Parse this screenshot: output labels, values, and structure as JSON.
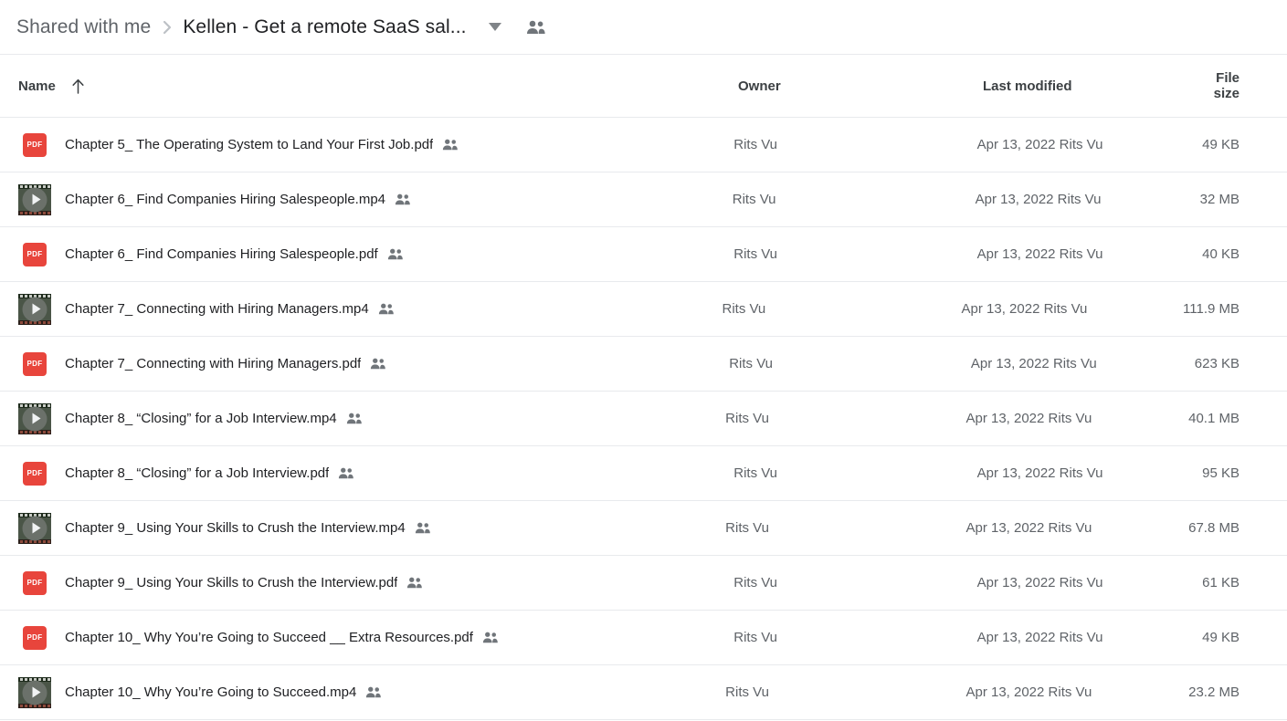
{
  "breadcrumb": {
    "root_label": "Shared with me",
    "separator": "›",
    "current_label": "Kellen - Get a remote SaaS sal...",
    "caret_icon": "chevron-down-icon",
    "people_icon": "people-shared-icon"
  },
  "columns": {
    "name": "Name",
    "owner": "Owner",
    "last_modified": "Last modified",
    "file_size": "File size",
    "sort_arrow": "↑",
    "sort_direction": "ascending"
  },
  "icons": {
    "pdf_label": "PDF",
    "pdf_color": "#e8453c",
    "video_label": "video-thumbnail-icon",
    "share_label": "shared-people-icon"
  },
  "files": [
    {
      "type": "pdf",
      "name": "Chapter 5_ The Operating System to Land Your First Job.pdf",
      "shared": true,
      "owner": "Rits Vu",
      "last_modified": "Apr 13, 2022  Rits Vu",
      "size": "49 KB"
    },
    {
      "type": "video",
      "name": "Chapter 6_ Find Companies Hiring Salespeople.mp4",
      "shared": true,
      "owner": "Rits Vu",
      "last_modified": "Apr 13, 2022  Rits Vu",
      "size": "32 MB"
    },
    {
      "type": "pdf",
      "name": "Chapter 6_ Find Companies Hiring Salespeople.pdf",
      "shared": true,
      "owner": "Rits Vu",
      "last_modified": "Apr 13, 2022  Rits Vu",
      "size": "40 KB"
    },
    {
      "type": "video",
      "name": "Chapter 7_ Connecting with Hiring Managers.mp4",
      "shared": true,
      "owner": "Rits Vu",
      "last_modified": "Apr 13, 2022  Rits Vu",
      "size": "111.9 MB"
    },
    {
      "type": "pdf",
      "name": "Chapter 7_ Connecting with Hiring Managers.pdf",
      "shared": true,
      "owner": "Rits Vu",
      "last_modified": "Apr 13, 2022  Rits Vu",
      "size": "623 KB"
    },
    {
      "type": "video",
      "name": "Chapter 8_ “Closing” for a Job Interview.mp4",
      "shared": true,
      "owner": "Rits Vu",
      "last_modified": "Apr 13, 2022  Rits Vu",
      "size": "40.1 MB"
    },
    {
      "type": "pdf",
      "name": "Chapter 8_ “Closing” for a Job Interview.pdf",
      "shared": true,
      "owner": "Rits Vu",
      "last_modified": "Apr 13, 2022  Rits Vu",
      "size": "95 KB"
    },
    {
      "type": "video",
      "name": "Chapter 9_ Using Your Skills to Crush the Interview.mp4",
      "shared": true,
      "owner": "Rits Vu",
      "last_modified": "Apr 13, 2022  Rits Vu",
      "size": "67.8 MB"
    },
    {
      "type": "pdf",
      "name": "Chapter 9_ Using Your Skills to Crush the Interview.pdf",
      "shared": true,
      "owner": "Rits Vu",
      "last_modified": "Apr 13, 2022  Rits Vu",
      "size": "61 KB"
    },
    {
      "type": "pdf",
      "name": "Chapter 10_ Why You’re Going to Succeed __ Extra Resources.pdf",
      "shared": true,
      "owner": "Rits Vu",
      "last_modified": "Apr 13, 2022  Rits Vu",
      "size": "49 KB"
    },
    {
      "type": "video",
      "name": "Chapter 10_ Why You’re Going to Succeed.mp4",
      "shared": true,
      "owner": "Rits Vu",
      "last_modified": "Apr 13, 2022  Rits Vu",
      "size": "23.2 MB"
    }
  ]
}
